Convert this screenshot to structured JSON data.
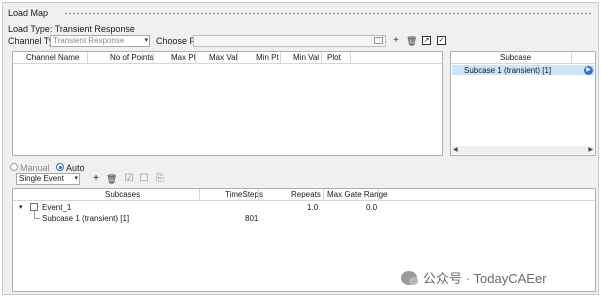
{
  "window": {
    "title": "Load Map"
  },
  "load_type": {
    "label": "Load Type: Transient Response"
  },
  "channel_type": {
    "label": "Channel Type:",
    "value": "Transient Response"
  },
  "choose_file": {
    "label": "Choose File:",
    "value": ""
  },
  "channel_table": {
    "columns": [
      "Channel Name",
      "No of Points",
      "Max Pt",
      "Max Val",
      "Min Pt",
      "Min Val",
      "Plot"
    ]
  },
  "subcase_table": {
    "header": "Subcase",
    "rows": [
      "Subcase 1 (transient) [1]"
    ]
  },
  "mode": {
    "manual_label": "Manual",
    "auto_label": "Auto",
    "selected": "Auto"
  },
  "event_type": {
    "value": "Single Event"
  },
  "events_table": {
    "columns": [
      "Subcases",
      "TimeSteps",
      "Repeats",
      "Max Gate Range"
    ],
    "event": {
      "name": "Event_1",
      "repeats": "1.0",
      "max_gate_range": "0.0"
    },
    "child": {
      "name": "Subcase 1 (transient) [1]",
      "timesteps": "801"
    }
  },
  "watermark": {
    "text": "公众号 · TodayCAEer"
  },
  "icons": {
    "add": "plus-icon",
    "delete": "trash-icon",
    "export": "export-icon",
    "import": "import-icon",
    "folder": "folder-icon",
    "play": "play-icon",
    "check": "check-icon",
    "square": "square-icon",
    "chart": "chart-icon"
  }
}
